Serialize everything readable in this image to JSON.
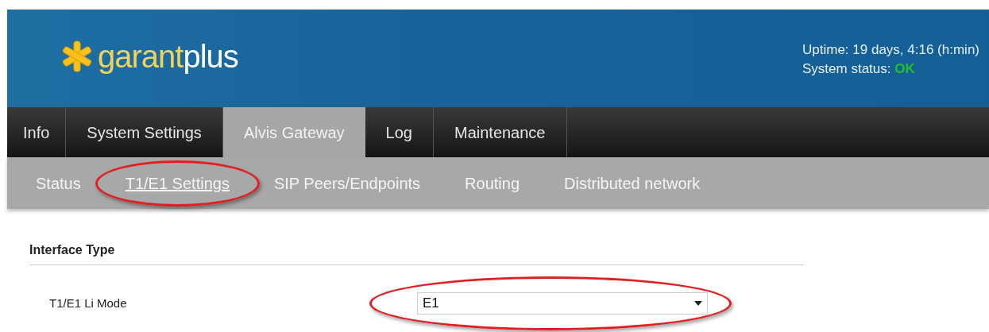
{
  "header": {
    "logo": {
      "first": "garant",
      "second": "plus"
    },
    "uptime": "Uptime: 19 days, 4:16 (h:min)",
    "status_label": "System status:",
    "status_value": "OK",
    "status_ok": true
  },
  "tabs": [
    {
      "label": "Info",
      "selected": false
    },
    {
      "label": "System Settings",
      "selected": false
    },
    {
      "label": "Alvis Gateway",
      "selected": true
    },
    {
      "label": "Log",
      "selected": false
    },
    {
      "label": "Maintenance",
      "selected": false
    }
  ],
  "subtabs": [
    {
      "label": "Status",
      "selected": false,
      "highlighted": false
    },
    {
      "label": "T1/E1 Settings",
      "selected": true,
      "highlighted": true
    },
    {
      "label": "SIP Peers/Endpoints",
      "selected": false,
      "highlighted": false
    },
    {
      "label": "Routing",
      "selected": false,
      "highlighted": false
    },
    {
      "label": "Distributed network",
      "selected": false,
      "highlighted": false
    }
  ],
  "section": {
    "title": "Interface Type",
    "fields": [
      {
        "label": "T1/E1 Li Mode",
        "value": "E1",
        "highlighted": true
      }
    ]
  }
}
